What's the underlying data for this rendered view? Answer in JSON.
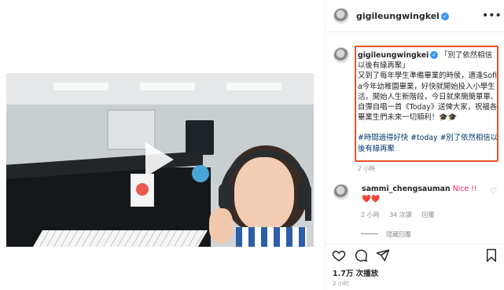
{
  "header": {
    "username": "gigileungwingkei"
  },
  "caption": {
    "username": "gigileungwingkei",
    "lines": [
      "「別了依然相信 以後有緣再聚」",
      "又到了每年學生準備畢業的時侯，適逢Sofia今年幼稚園畢業，好快就開始投入小學生活，開始人生新階段，今日就來簡簡單單、自彈自唱一首《Today》送俾大家，祝福各畢業生們未來一切順利！🎓🎓"
    ],
    "hashtags": "#時間過得好快 #today #別了依然相信以後有緣再聚",
    "time": "2 小時"
  },
  "comment": {
    "username": "sammi_chengsauman",
    "text": "Nice !! ❤️❤️",
    "time": "2 小時",
    "likes": "34 次讚",
    "reply": "回覆",
    "hide_replies": "隱藏回覆"
  },
  "post": {
    "views": "1.7万 次播放",
    "time": "2 小时"
  },
  "colors": {
    "highlight_border": "#e8532c",
    "verified": "#3897f0",
    "heart": "#e0245e"
  },
  "icons": {
    "video_play": "play-icon",
    "more": "more-icon",
    "like": "heart-icon",
    "comment": "comment-icon",
    "share": "share-icon",
    "save": "bookmark-icon"
  }
}
